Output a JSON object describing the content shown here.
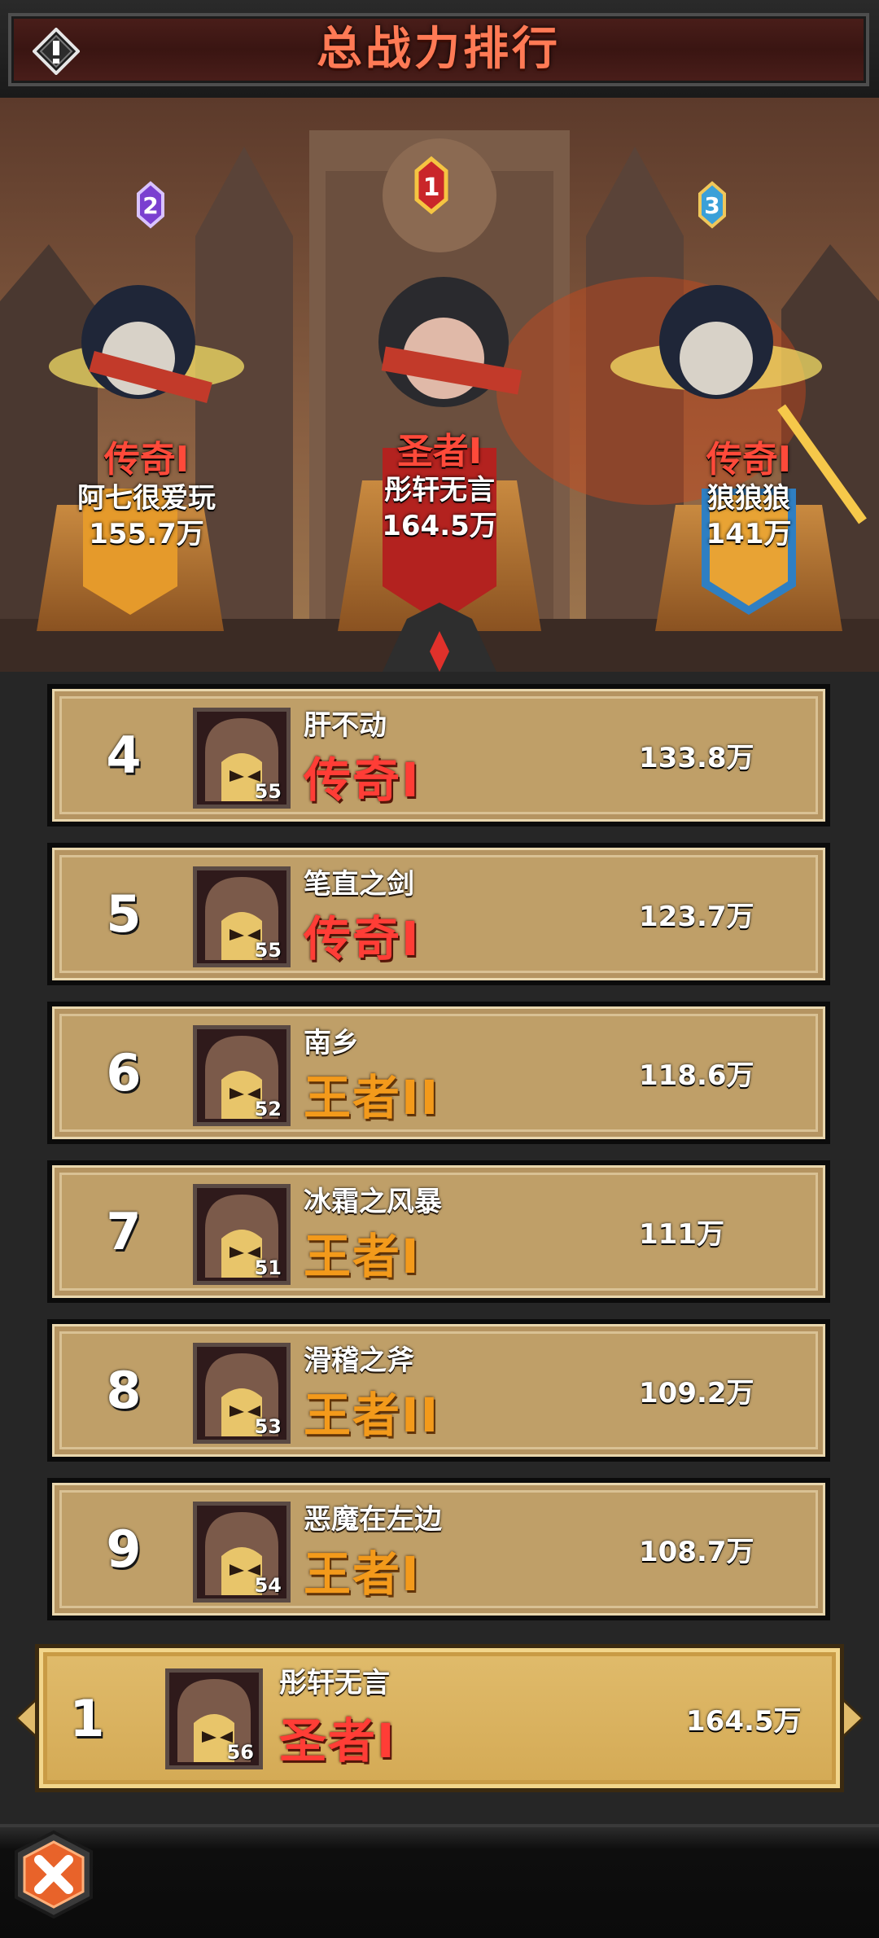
{
  "header": {
    "title": "总战力排行"
  },
  "podium": [
    {
      "rank": "2",
      "tier": "传奇I",
      "name": "阿七很爱玩",
      "power": "155.7万"
    },
    {
      "rank": "1",
      "tier": "圣者I",
      "name": "彤轩无言",
      "power": "164.5万"
    },
    {
      "rank": "3",
      "tier": "传奇I",
      "name": "狼狼狼",
      "power": "141万"
    }
  ],
  "rows": [
    {
      "rank": "4",
      "name": "肝不动",
      "level": "55",
      "tier": "传奇I",
      "power": "133.8万"
    },
    {
      "rank": "5",
      "name": "笔直之剑",
      "level": "55",
      "tier": "传奇I",
      "power": "123.7万"
    },
    {
      "rank": "6",
      "name": "南乡",
      "level": "52",
      "tier": "王者II",
      "power": "118.6万"
    },
    {
      "rank": "7",
      "name": "冰霜之风暴",
      "level": "51",
      "tier": "王者I",
      "power": "111万"
    },
    {
      "rank": "8",
      "name": "滑稽之斧",
      "level": "53",
      "tier": "王者II",
      "power": "109.2万"
    },
    {
      "rank": "9",
      "name": "恶魔在左边",
      "level": "54",
      "tier": "王者I",
      "power": "108.7万"
    }
  ],
  "self": {
    "rank": "1",
    "name": "彤轩无言",
    "level": "56",
    "tier": "圣者I",
    "power": "164.5万"
  },
  "colors": {
    "legend_tier": "#ff3d36",
    "king_tier": "#f39a1b",
    "title": "#ff7a55"
  },
  "icons": {
    "info": "warning-diamond-icon",
    "close": "close-x-icon"
  }
}
